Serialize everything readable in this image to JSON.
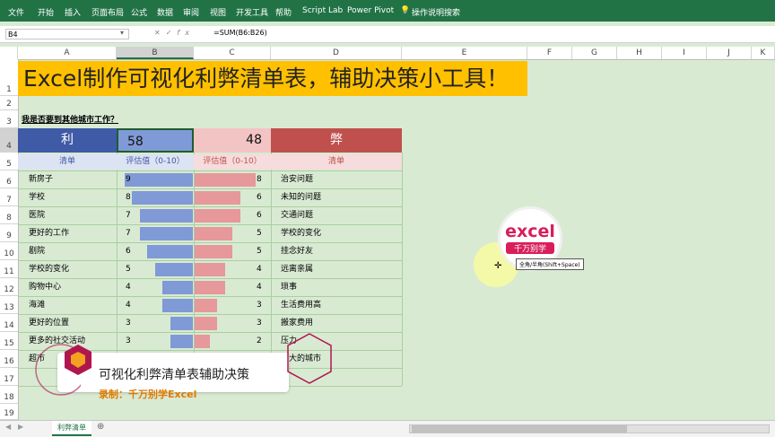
{
  "ribbon": {
    "tabs": [
      "文件",
      "开始",
      "插入",
      "页面布局",
      "公式",
      "数据",
      "审阅",
      "视图",
      "开发工具",
      "帮助",
      "Script Lab",
      "Power Pivot",
      "操作说明搜索"
    ]
  },
  "formula_bar": {
    "name_box": "B4",
    "formula": "=SUM(B6:B26)"
  },
  "columns": [
    "A",
    "B",
    "C",
    "D",
    "E",
    "F",
    "G",
    "H",
    "I",
    "J",
    "K",
    "L"
  ],
  "rows": [
    "1",
    "2",
    "3",
    "4",
    "5",
    "6",
    "7",
    "8",
    "9",
    "10",
    "11",
    "12",
    "13",
    "14",
    "15",
    "16",
    "17",
    "18",
    "19"
  ],
  "sheet": {
    "title": "Excel制作可视化利弊清单表，辅助决策小工具！",
    "question": "我是否要到其他城市工作？",
    "pro_header": "利",
    "pro_total": "58",
    "con_total": "48",
    "con_header": "弊",
    "pro_list_label": "清单",
    "pro_score_label": "评估值（0-10）",
    "con_score_label": "评估值（0-10）",
    "con_list_label": "清单",
    "pros": [
      {
        "item": "新房子",
        "score": 9
      },
      {
        "item": "学校",
        "score": 8
      },
      {
        "item": "医院",
        "score": 7
      },
      {
        "item": "更好的工作",
        "score": 7
      },
      {
        "item": "剧院",
        "score": 6
      },
      {
        "item": "学校的变化",
        "score": 5
      },
      {
        "item": "购物中心",
        "score": 4
      },
      {
        "item": "海滩",
        "score": 4
      },
      {
        "item": "更好的位置",
        "score": 3
      },
      {
        "item": "更多的社交活动",
        "score": 3
      },
      {
        "item": "超市",
        "score": 2
      }
    ],
    "cons": [
      {
        "item": "治安问题",
        "score": 8
      },
      {
        "item": "未知的问题",
        "score": 6
      },
      {
        "item": "交通问题",
        "score": 6
      },
      {
        "item": "学校的变化",
        "score": 5
      },
      {
        "item": "挂念好友",
        "score": 5
      },
      {
        "item": "远离亲属",
        "score": 4
      },
      {
        "item": "琐事",
        "score": 4
      },
      {
        "item": "生活费用高",
        "score": 3
      },
      {
        "item": "搬家费用",
        "score": 3
      },
      {
        "item": "压力",
        "score": 2
      },
      {
        "item": "更大的城市",
        "score": 0
      }
    ],
    "colors": {
      "pro_dark": "#3f5aa6",
      "pro_bar": "#7f9ad6",
      "con_dark": "#c0504d",
      "con_bar": "#e6989a",
      "con_light": "#f2c4c4",
      "header": "#ffc000"
    }
  },
  "watermark": {
    "logo_text": "excel",
    "logo_sub": "千万别学",
    "tooltip": "全角/半角(Shift+Space)"
  },
  "overlay": {
    "title": "可视化利弊清单表辅助决策",
    "subtitle": "录制：千万别学Excel"
  },
  "sheet_tabs": {
    "active": "利弊清单",
    "add": "⊕"
  }
}
